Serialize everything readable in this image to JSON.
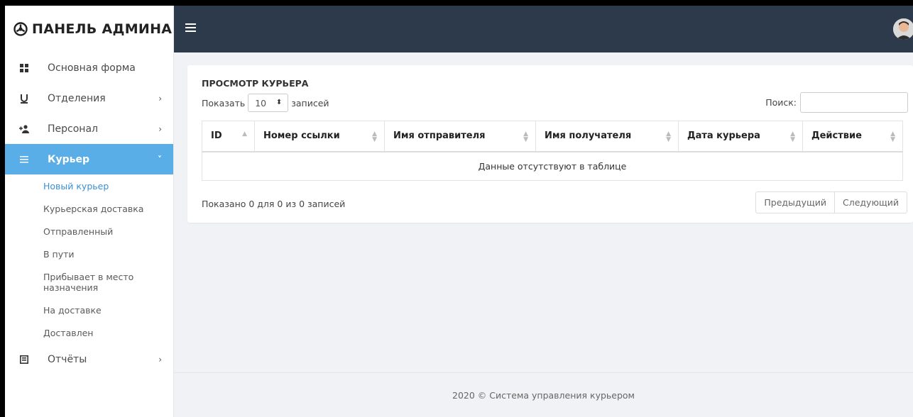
{
  "brand": {
    "title": "ПАНЕЛЬ АДМИНА"
  },
  "sidebar": {
    "items": [
      {
        "label": "Основная форма",
        "icon": "dashboard-icon"
      },
      {
        "label": "Отделения",
        "icon": "branch-icon"
      },
      {
        "label": "Персонал",
        "icon": "staff-icon"
      },
      {
        "label": "Курьер",
        "icon": "list-icon"
      },
      {
        "label": "Отчёты",
        "icon": "report-icon"
      }
    ],
    "courier_sub": [
      "Новый курьер",
      "Курьерская доставка",
      "Отправленный",
      "В пути",
      "Прибывает в место назначения",
      "На доставке",
      "Доставлен"
    ]
  },
  "card": {
    "title": "ПРОСМОТР КУРЬЕРА",
    "show_label": "Показать",
    "show_value": "10",
    "records_label": "записей",
    "search_label": "Поиск:",
    "search_value": "",
    "columns": [
      "ID",
      "Номер ссылки",
      "Имя отправителя",
      "Имя получателя",
      "Дата курьера",
      "Действие"
    ],
    "empty_text": "Данные отсутствуют в таблице",
    "info_text": "Показано 0 для 0 из 0 записей",
    "prev_label": "Предыдущий",
    "next_label": "Следующий"
  },
  "footer": {
    "text": "2020 © Система управления курьером"
  },
  "colors": {
    "topbar": "#2d3a4b",
    "active": "#5aaee8",
    "link": "#3b8fd4"
  }
}
